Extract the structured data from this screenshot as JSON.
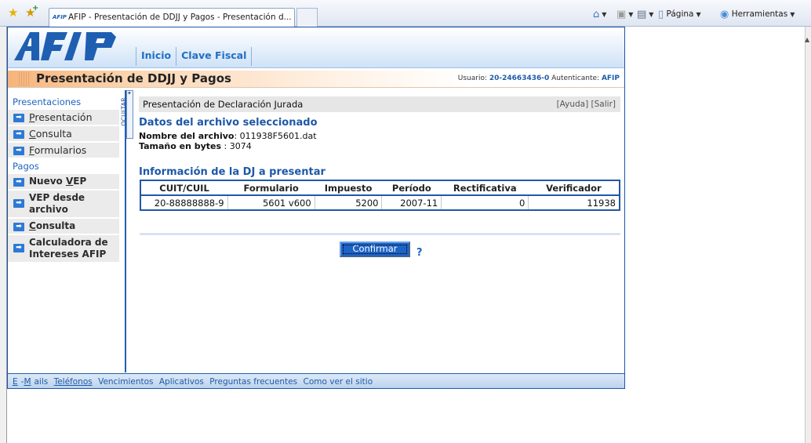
{
  "browser": {
    "tab_title": "AFIP - Presentación de DDJJ y Pagos - Presentación d...",
    "tab_logo": "AFIP",
    "commands": {
      "page": "Página",
      "tools": "Herramientas"
    }
  },
  "header": {
    "nav": [
      "Inicio",
      "Clave Fiscal"
    ]
  },
  "title_bar": {
    "title": "Presentación de DDJJ y Pagos",
    "user_label": "Usuario:",
    "user_value": "20-24663436-0",
    "auth_label": "Autenticante:",
    "auth_value": "AFIP"
  },
  "menu": {
    "sections": {
      "presentaciones": "Presentaciones",
      "pagos": "Pagos"
    },
    "presentaciones_items": [
      {
        "first": "P",
        "rest": "resentación"
      },
      {
        "first": "C",
        "rest": "onsulta"
      },
      {
        "first": "F",
        "rest": "ormularios"
      }
    ],
    "pagos_items": {
      "nuevo_vep_pre": "Nuevo ",
      "nuevo_vep_u": "V",
      "nuevo_vep_post": "EP",
      "vep_archivo": "VEP desde archivo",
      "consulta_first": "C",
      "consulta_rest": "onsulta",
      "calculadora": "Calculadora de Intereses AFIP"
    },
    "ocultar": "OCULTAR"
  },
  "main": {
    "panel_title": "Presentación de Declaración Jurada",
    "panel_links": "[Ayuda] [Salir]",
    "file_section_title": "Datos del archivo seleccionado",
    "file_name_label": "Nombre del archivo",
    "file_name_value": ": 011938F5601.dat",
    "file_size_label": "Tamaño en bytes",
    "file_size_value": " : 3074",
    "dj_section_title": "Información de la DJ a presentar",
    "table": {
      "headers": [
        "CUIT/CUIL",
        "Formulario",
        "Impuesto",
        "Período",
        "Rectificativa",
        "Verificador"
      ],
      "row": [
        "20-88888888-9",
        "5601 v600",
        "5200",
        "2007-11",
        "0",
        "11938"
      ]
    },
    "confirm_label": "Confirmar",
    "help_label": "?"
  },
  "footer": {
    "links": [
      "E-Mails",
      "Teléfonos",
      "Vencimientos",
      "Aplicativos",
      "Preguntas frecuentes",
      "Como ver el sitio"
    ]
  }
}
